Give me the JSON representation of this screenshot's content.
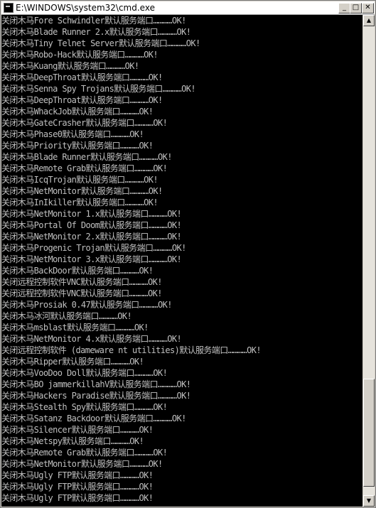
{
  "window": {
    "title": "E:\\WINDOWS\\system32\\cmd.exe",
    "controls": {
      "minimize": "_",
      "maximize": "□",
      "close": "✕"
    }
  },
  "scrollbar": {
    "up": "▲",
    "down": "▼",
    "position": 0.74
  },
  "console_lines": [
    "关闭木马Fore Schwindler默认服务端口…………OK!",
    "关闭木马Blade Runner 2.x默认服务端口…………OK!",
    "关闭木马Tiny Telnet Server默认服务端口…………OK!",
    "关闭木马Robo-Hack默认服务端口…………OK!",
    "关闭木马Kuang默认服务端口…………OK!",
    "关闭木马DeepThroat默认服务端口…………OK!",
    "关闭木马Senna Spy Trojans默认服务端口…………OK!",
    "关闭木马DeepThroat默认服务端口…………OK!",
    "关闭木马WhackJob默认服务端口…………OK!",
    "关闭木马GateCrasher默认服务端口…………OK!",
    "关闭木马Phase0默认服务端口…………OK!",
    "关闭木马Priority默认服务端口…………OK!",
    "关闭木马Blade Runner默认服务端口…………OK!",
    "关闭木马Remote Grab默认服务端口…………OK!",
    "关闭木马IcqTrojan默认服务端口…………OK!",
    "关闭木马NetMonitor默认服务端口…………OK!",
    "关闭木马InIkiller默认服务端口…………OK!",
    "关闭木马NetMonitor 1.x默认服务端口…………OK!",
    "关闭木马Portal Of Doom默认服务端口…………OK!",
    "关闭木马NetMonitor 2.x默认服务端口…………OK!",
    "关闭木马Progenic Trojan默认服务端口…………OK!",
    "关闭木马NetMonitor 3.x默认服务端口…………OK!",
    "关闭木马BackDoor默认服务端口…………OK!",
    "关闭远程控制软件VNC默认服务端口…………OK!",
    "关闭远程控制软件VNC默认服务端口…………OK!",
    "关闭木马Prosiak 0.47默认服务端口…………OK!",
    "关闭木马冰河默认服务端口…………OK!",
    "关闭木马msblast默认服务端口…………OK!",
    "关闭木马NetMonitor 4.x默认服务端口…………OK!",
    "关闭远程控制软件 (dameware nt utilities)默认服务端口…………OK!",
    "关闭木马Ripper默认服务端口…………OK!",
    "关闭木马VooDoo Doll默认服务端口…………OK!",
    "关闭木马BO jammerkillahV默认服务端口…………OK!",
    "关闭木马Hackers Paradise默认服务端口…………OK!",
    "关闭木马Stealth Spy默认服务端口…………OK!",
    "关闭木马Satanz Backdoor默认服务端口…………OK!",
    "关闭木马Silencer默认服务端口…………OK!",
    "关闭木马Netspy默认服务端口…………OK!",
    "关闭木马Remote Grab默认服务端口…………OK!",
    "关闭木马NetMonitor默认服务端口…………OK!",
    "关闭木马Ugly FTP默认服务端口…………OK!",
    "关闭木马Ugly FTP默认服务端口…………OK!",
    "关闭木马Ugly FTP默认服务端口…………OK!"
  ]
}
